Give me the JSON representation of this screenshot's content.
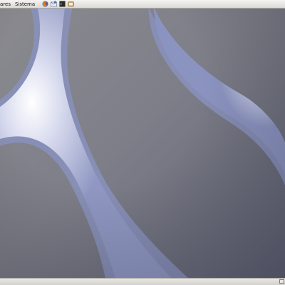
{
  "top_panel": {
    "menus": [
      {
        "label": "ares"
      },
      {
        "label": "Sistema"
      }
    ],
    "launchers": [
      {
        "icon": "firefox-icon"
      },
      {
        "icon": "mail-client-icon"
      },
      {
        "icon": "terminal-icon"
      },
      {
        "icon": "file-manager-icon"
      }
    ]
  },
  "bottom_panel": {
    "show_desktop_icon": "show-desktop-icon"
  },
  "colors": {
    "panel": "#dcdad5",
    "wallpaper_dark": "#6f707e",
    "wallpaper_swoosh": "#eef0fa",
    "swoosh_edge": "#8c94bf"
  }
}
